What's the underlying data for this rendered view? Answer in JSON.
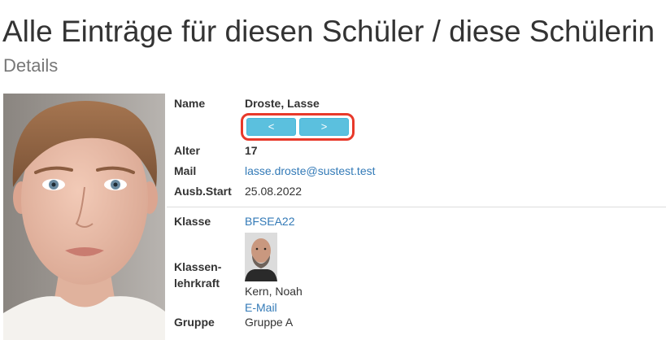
{
  "header": {
    "title": "Alle Einträge für diesen Schüler / diese Schülerin",
    "subtitle": "Details"
  },
  "student": {
    "name_label": "Name",
    "name": "Droste, Lasse",
    "prev_label": "<",
    "next_label": ">",
    "age_label": "Alter",
    "age": "17",
    "mail_label": "Mail",
    "mail": "lasse.droste@sustest.test",
    "start_label": "Ausb.Start",
    "start": "25.08.2022"
  },
  "class": {
    "class_label": "Klasse",
    "class_value": "BFSEA22",
    "teacher_label_line1": "Klassen-",
    "teacher_label_line2": "lehrkraft",
    "teacher_name": "Kern, Noah",
    "teacher_email_label": "E-Mail",
    "group_label": "Gruppe",
    "group_value": "Gruppe A"
  },
  "colors": {
    "link": "#337ab7",
    "button": "#5bc0de",
    "highlight": "#e8392a"
  }
}
